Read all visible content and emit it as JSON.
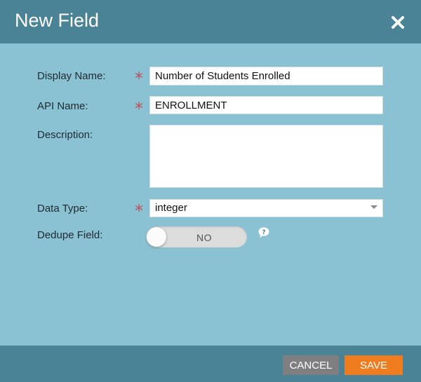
{
  "dialog": {
    "title": "New Field"
  },
  "form": {
    "display_name": {
      "label": "Display Name:",
      "value": "Number of Students Enrolled",
      "required": true
    },
    "api_name": {
      "label": "API Name:",
      "value": "ENROLLMENT",
      "required": true
    },
    "description": {
      "label": "Description:",
      "value": ""
    },
    "data_type": {
      "label": "Data Type:",
      "selected": "integer",
      "required": true
    },
    "dedupe": {
      "label": "Dedupe Field:",
      "toggle_text": "NO",
      "state": "off"
    }
  },
  "footer": {
    "cancel_label": "CANCEL",
    "save_label": "SAVE"
  },
  "colors": {
    "header": "#4a8395",
    "body": "#8ac2d3",
    "required_star": "#b9515c",
    "cancel": "#7f7f82",
    "save": "#ef7c1f"
  },
  "icons": {
    "close": "close-icon",
    "help": "help-bubble-icon",
    "dropdown": "chevron-down-icon",
    "required": "asterisk"
  }
}
